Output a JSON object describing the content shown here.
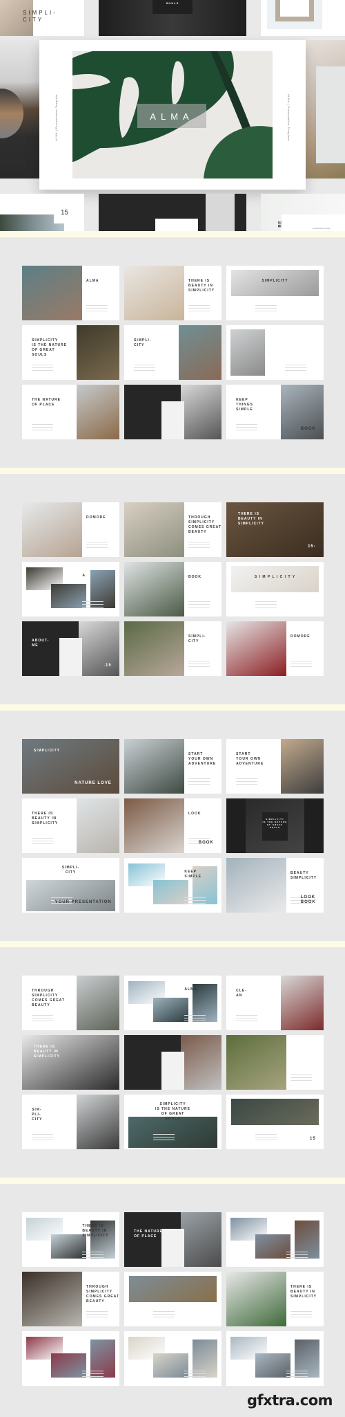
{
  "hero": {
    "top_left_title": "SIMPLI-\nCITY",
    "top_center_label": "SOULS",
    "main_title": "ALMA",
    "side_caption": "ALMA | Presentation Template",
    "bottom_left_number": "15",
    "bottom_right_title": "RE",
    "bottom_right_caption": "presentation books"
  },
  "sections": [
    {
      "slides": [
        {
          "title": "ALMA"
        },
        {
          "title": "THERE IS\nBEAUTY IN\nSIMPLICITY"
        },
        {
          "title": "SIMPLICITY"
        },
        {
          "title": "SIMPLICITY\nIS THE NATURE\nOF GREAT\nSOULS"
        },
        {
          "title": "SIMPLI-\nCITY"
        },
        {
          "title": ""
        },
        {
          "title": "THE NATURE\nOF PLACE"
        },
        {
          "title": ""
        },
        {
          "title": "KEEP\nTHINGS\nSIMPLE",
          "extra": "BOOK"
        }
      ]
    },
    {
      "slides": [
        {
          "title": "DOMORE"
        },
        {
          "title": "THROUGH\nSIMPLICITY\nCOMES GREAT\nBEAUTY"
        },
        {
          "title": "THERE IS\nBEAUTY IN\nSIMPLICITY",
          "extra": "15-"
        },
        {
          "title": "A"
        },
        {
          "title": "BOOK"
        },
        {
          "title": "S I M P L I C I T Y"
        },
        {
          "title": "ABOUT-\nME",
          "extra": ".15"
        },
        {
          "title": "SIMPLI-\nCITY"
        },
        {
          "title": "DOMORE"
        }
      ]
    },
    {
      "slides": [
        {
          "title": "SIMPLICITY",
          "extra": "NATURE LOVE"
        },
        {
          "title": "START\nYOUR OWN\nADVENTURE"
        },
        {
          "title": "START\nYOUR OWN\nADVENTURE"
        },
        {
          "title": "THERE IS\nBEAUTY IN\nSIMPLICITY"
        },
        {
          "title": "LOOK",
          "extra": "BOOK"
        },
        {
          "title": "SIMPLICITY\nIS THE NATURE\nOF GREAT\nSOULS"
        },
        {
          "title": "SIMPLI-\nCITY",
          "extra": "YOUR PRESENTATION"
        },
        {
          "title": "KEEP\nSIMPLE"
        },
        {
          "title": "BEAUTY\nSIMPLICITY",
          "extra": "LOOK\nBOOK"
        }
      ]
    },
    {
      "slides": [
        {
          "title": "THROUGH\nSIMPLICITY\nCOMES GREAT\nBEAUTY"
        },
        {
          "title": "ALMA"
        },
        {
          "title": "CLE-\nAN"
        },
        {
          "title": "THERE IS\nBEAUTY IN\nSIMPLICITY"
        },
        {
          "title": ""
        },
        {
          "title": ""
        },
        {
          "title": "SIM-\nPLI-\nCITY"
        },
        {
          "title": "SIMPLICITY\nIS THE NATURE\nOF GREAT\nSOULS"
        },
        {
          "title": "",
          "extra": "15"
        }
      ]
    },
    {
      "slides": [
        {
          "title": "THERE IS\nBEAUTY IN\nSIMPLICITY"
        },
        {
          "title": "THE NATURE\nOF PLACE"
        },
        {
          "title": ""
        },
        {
          "title": "THROUGH\nSIMPLICITY\nCOMES GREAT\nBEAUTY"
        },
        {
          "title": ""
        },
        {
          "title": "THERE IS\nBEAUTY IN\nSIMPLICITY"
        },
        {
          "title": ""
        },
        {
          "title": ""
        },
        {
          "title": ""
        }
      ]
    }
  ],
  "watermark": "gfxtra.com",
  "colors": {
    "background": "#e8e8e8",
    "separator": "#fdfbe6",
    "dark_slide": "#262626",
    "leaf_green": "#1f4d32"
  }
}
